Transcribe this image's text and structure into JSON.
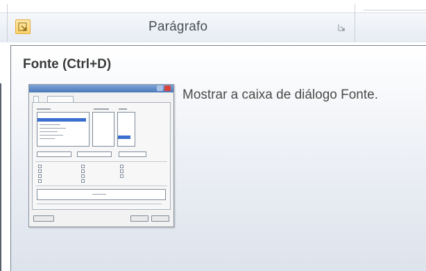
{
  "ribbon": {
    "group_label": "Parágrafo",
    "left_launcher_icon": "dialog-launcher-icon",
    "right_launcher_icon": "dialog-launcher-icon"
  },
  "tooltip": {
    "title": "Fonte (Ctrl+D)",
    "description": "Mostrar a caixa de diálogo Fonte.",
    "preview_image": "font-dialog-preview"
  },
  "colors": {
    "launcher_highlight": "#fbd36a",
    "tooltip_border": "#76808e",
    "ribbon_bg": "#e6ebf2"
  }
}
